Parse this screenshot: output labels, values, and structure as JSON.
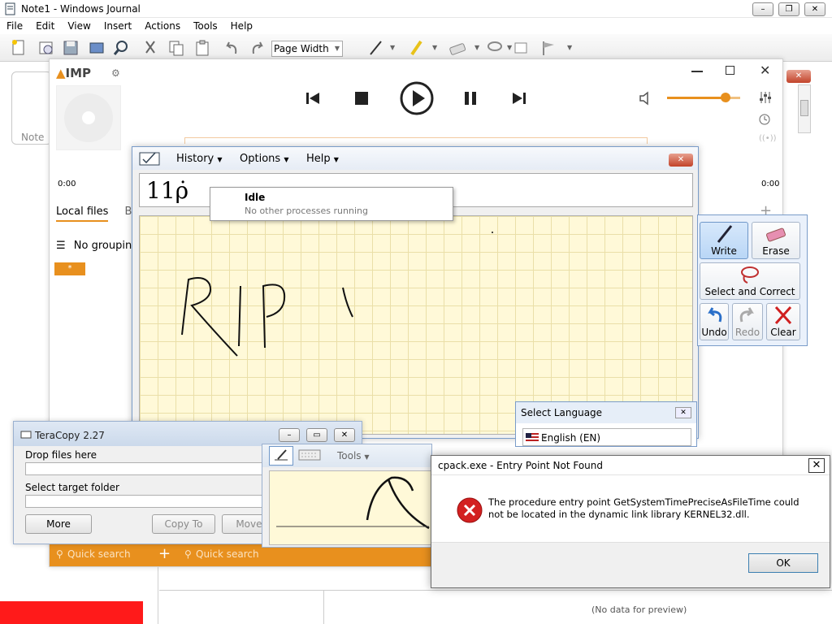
{
  "journal": {
    "title": "Note1 - Windows Journal",
    "menu": [
      "File",
      "Edit",
      "View",
      "Insert",
      "Actions",
      "Tools",
      "Help"
    ],
    "zoom": "Page Width",
    "note_label": "Note",
    "no_preview": "(No data for preview)"
  },
  "aimp": {
    "logo": "IMP",
    "time_start": "0:00",
    "time_end": "0:00",
    "tab_local": "Local files",
    "tab_other": "Bo",
    "grouping": "No groupin",
    "chip": "*",
    "quick_search_1": "Quick search",
    "quick_search_2": "Quick search",
    "volume_percent": 80,
    "accent": "#e8901e"
  },
  "math": {
    "menu": [
      "History",
      "Options",
      "Help"
    ],
    "preview_text": "11ρ̇",
    "tools": {
      "write": "Write",
      "erase": "Erase",
      "select_correct": "Select and Correct",
      "undo": "Undo",
      "redo": "Redo",
      "clear": "Clear"
    }
  },
  "idle": {
    "title": "Idle",
    "subtitle": "No other processes running"
  },
  "language": {
    "title": "Select Language",
    "selected": "English (EN)"
  },
  "teracopy": {
    "title": "TeraCopy 2.27",
    "drop_label": "Drop files here",
    "target_label": "Select target folder",
    "more": "More",
    "copy_to": "Copy To",
    "move_to": "Move T"
  },
  "ink": {
    "tools": "Tools"
  },
  "error": {
    "title": "cpack.exe - Entry Point Not Found",
    "message": "The procedure entry point GetSystemTimePreciseAsFileTime could not be located in the dynamic link library KERNEL32.dll.",
    "ok": "OK"
  }
}
